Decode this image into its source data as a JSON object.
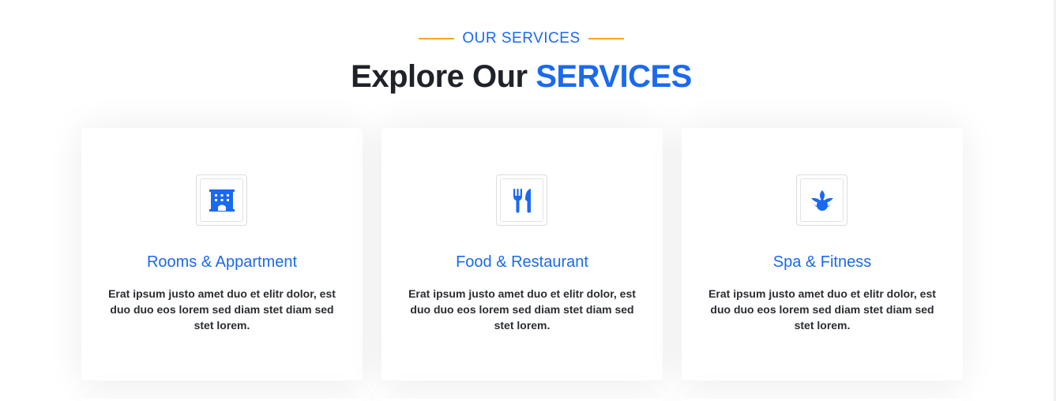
{
  "section": {
    "eyebrow": "OUR SERVICES",
    "heading_main": "Explore Our",
    "heading_accent": "SERVICES"
  },
  "colors": {
    "accent": "#1b69f0",
    "rule": "#f5a623",
    "heading": "#1f2229"
  },
  "services": [
    {
      "icon": "hotel-icon",
      "title": "Rooms & Appartment",
      "text": "Erat ipsum justo amet duo et elitr dolor, est duo duo eos lorem sed diam stet diam sed stet lorem."
    },
    {
      "icon": "utensils-icon",
      "title": "Food & Restaurant",
      "text": "Erat ipsum justo amet duo et elitr dolor, est duo duo eos lorem sed diam stet diam sed stet lorem."
    },
    {
      "icon": "spa-icon",
      "title": "Spa & Fitness",
      "text": "Erat ipsum justo amet duo et elitr dolor, est duo duo eos lorem sed diam stet diam sed stet lorem."
    }
  ]
}
